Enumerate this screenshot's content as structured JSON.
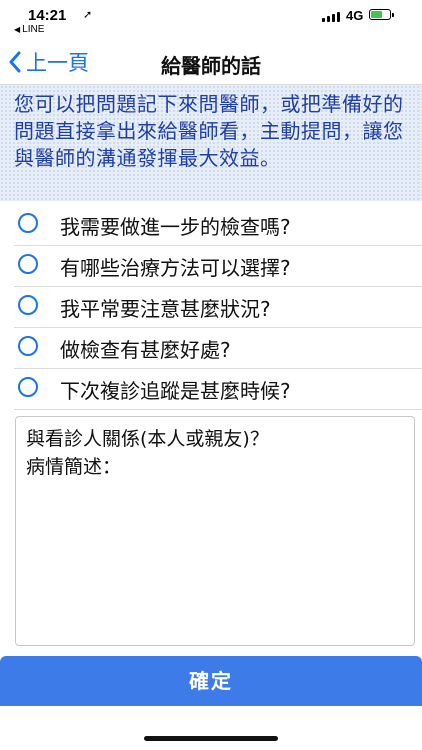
{
  "status_bar": {
    "time": "14:21",
    "back_app": "LINE",
    "network": "4G",
    "icons": [
      "location-arrow-icon",
      "signal-bars-icon",
      "battery-charging-icon"
    ]
  },
  "nav": {
    "back_label": "上一頁",
    "title": "給醫師的話"
  },
  "intro": {
    "text": "您可以把問題記下來問醫師，或把準備好的問題直接拿出來給醫師看，主動提問，讓您與醫師的溝通發揮最大效益。"
  },
  "questions": [
    {
      "label": "我需要做進一步的檢查嗎?"
    },
    {
      "label": "有哪些治療方法可以選擇?"
    },
    {
      "label": "我平常要注意甚麼狀況?"
    },
    {
      "label": "做檢查有甚麼好處?"
    },
    {
      "label": "下次複診追蹤是甚麼時候?"
    }
  ],
  "note": {
    "line1": "與看診人關係(本人或親友)？",
    "line2": "病情簡述："
  },
  "confirm_label": "確定",
  "colors": {
    "accent": "#1a73e8",
    "intro_text": "#1f3fa8",
    "button": "#3d7be8"
  }
}
